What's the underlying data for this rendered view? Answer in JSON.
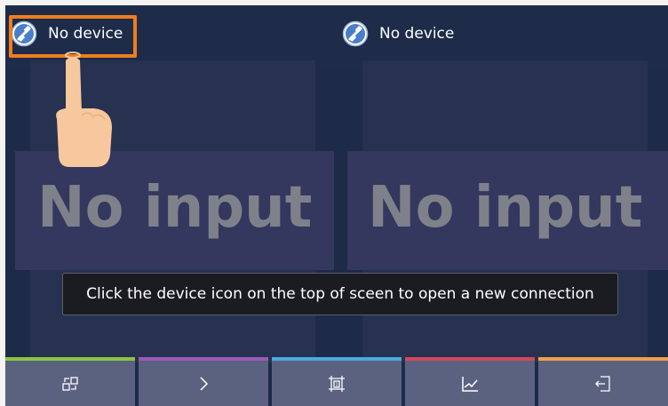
{
  "top_bar": {
    "left_device": {
      "label": "No device",
      "icon": "device-disconnected-icon"
    },
    "right_device": {
      "label": "No device",
      "icon": "device-disconnected-icon"
    }
  },
  "panels": {
    "left": {
      "status": "No input"
    },
    "right": {
      "status": "No input"
    }
  },
  "tooltip": {
    "text": "Click the device icon on the top of sceen to open a new connection"
  },
  "bottom_tabs": [
    {
      "icon": "transfer-icon",
      "accent": "#8bc53f"
    },
    {
      "icon": "chevron-right-icon",
      "accent": "#9b59b6"
    },
    {
      "icon": "frame-one-icon",
      "accent": "#4aa9e0"
    },
    {
      "icon": "chart-icon",
      "accent": "#d6465a"
    },
    {
      "icon": "exit-icon",
      "accent": "#f0a048"
    }
  ],
  "colors": {
    "highlight": "#f07e1c",
    "background": "#1d2a48",
    "tab_bg": "#5b6280"
  }
}
